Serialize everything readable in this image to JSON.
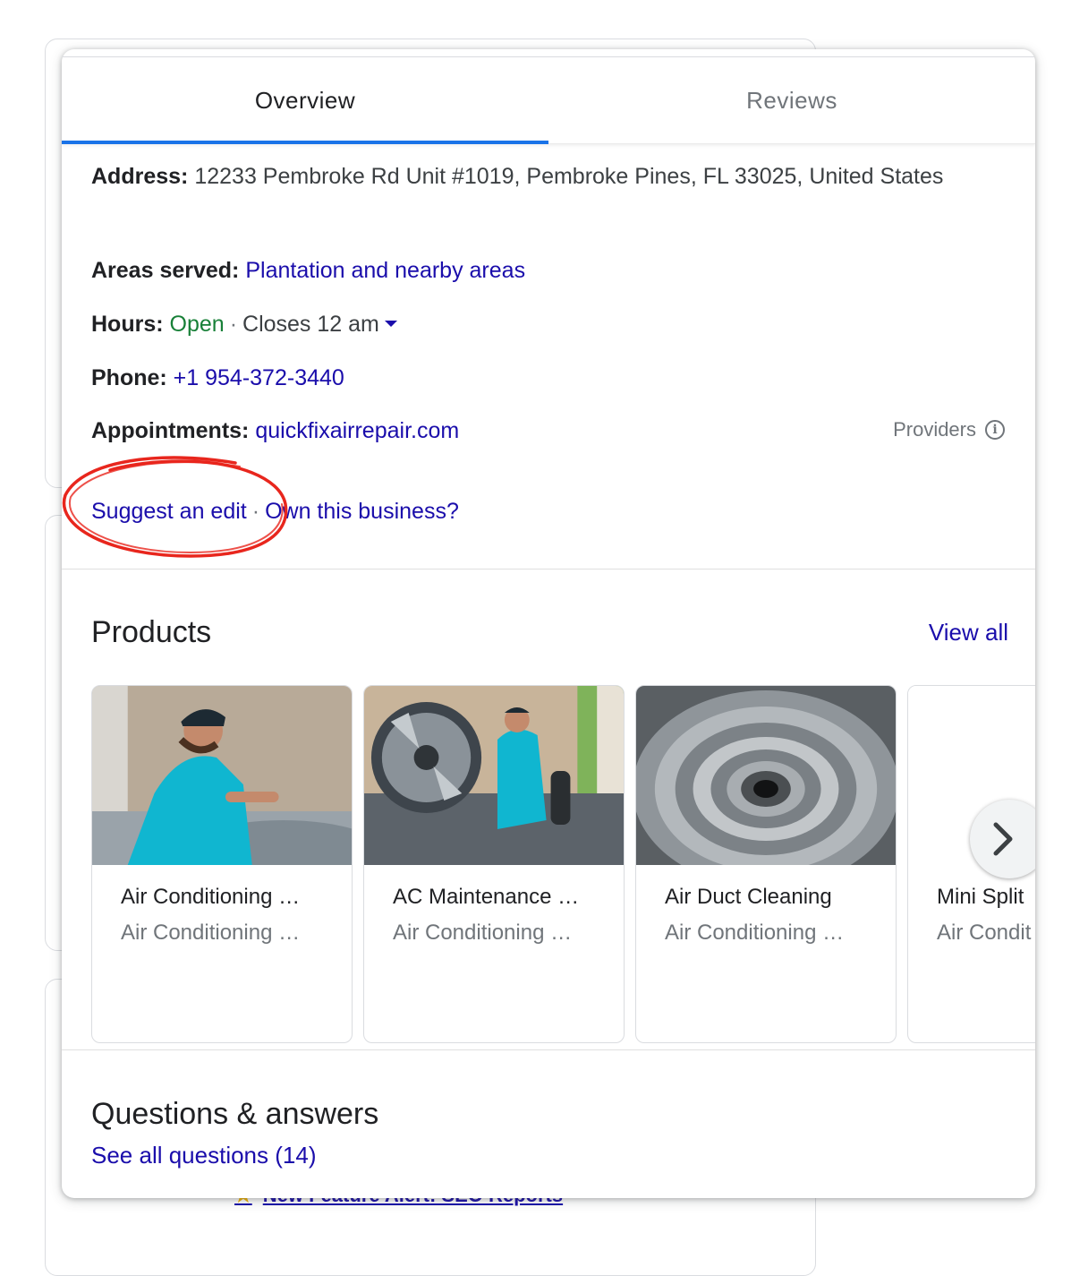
{
  "background": {
    "alert_text": "New Feature Alert: SEO Reports"
  },
  "tabs": [
    {
      "label": "Overview",
      "active": true
    },
    {
      "label": "Reviews",
      "active": false
    }
  ],
  "info": {
    "address_label": "Address:",
    "address_value": "12233 Pembroke Rd Unit #1019, Pembroke Pines, FL 33025, United States",
    "areas_label": "Areas served:",
    "areas_value": "Plantation and nearby areas",
    "hours_label": "Hours:",
    "hours_status": "Open",
    "hours_sep": "·",
    "hours_close": "Closes 12 am",
    "phone_label": "Phone:",
    "phone_value": "+1 954-372-3440",
    "appointments_label": "Appointments:",
    "appointments_value": "quickfixairrepair.com",
    "providers_label": "Providers",
    "providers_icon": "i"
  },
  "edit": {
    "suggest_label": "Suggest an edit",
    "sep": "·",
    "own_label": "Own this business?"
  },
  "products": {
    "heading": "Products",
    "view_all": "View all",
    "items": [
      {
        "title": "Air Conditioning …",
        "subtitle": "Air Conditioning …"
      },
      {
        "title": "AC Maintenance …",
        "subtitle": "Air Conditioning …"
      },
      {
        "title": "Air Duct Cleaning",
        "subtitle": "Air Conditioning …"
      },
      {
        "title": "Mini Split",
        "subtitle": "Air Condit"
      }
    ]
  },
  "qa": {
    "heading": "Questions & answers",
    "see_all": "See all questions (14)"
  },
  "colors": {
    "link": "#1a0dab",
    "open": "#188038",
    "tab_indicator": "#1a73e8",
    "annotation": "#e8261d"
  }
}
